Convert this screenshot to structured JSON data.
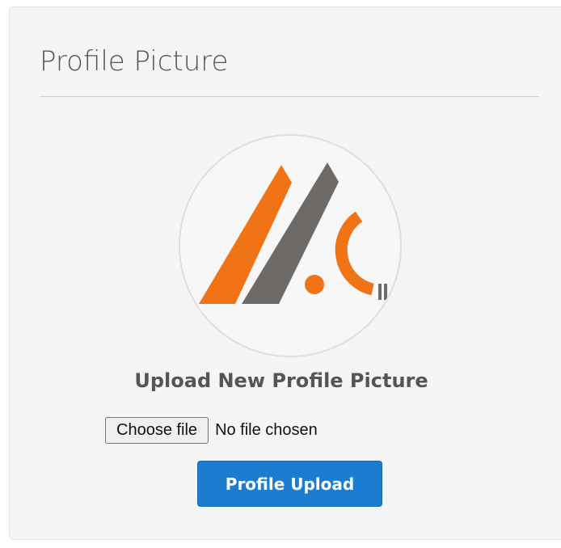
{
  "card": {
    "title": "Profile Picture"
  },
  "avatar": {
    "logo_icon": "brand-logo-icon",
    "colors": {
      "orange": "#f07416",
      "gray": "#6e6a68",
      "border": "#dedede"
    }
  },
  "upload": {
    "heading": "Upload New Profile Picture",
    "choose_file_label": "Choose file",
    "file_status": "No file chosen",
    "submit_label": "Profile Upload"
  },
  "colors": {
    "primary": "#1c7dd0",
    "card_background": "#f5f5f5",
    "text": "#555555"
  }
}
